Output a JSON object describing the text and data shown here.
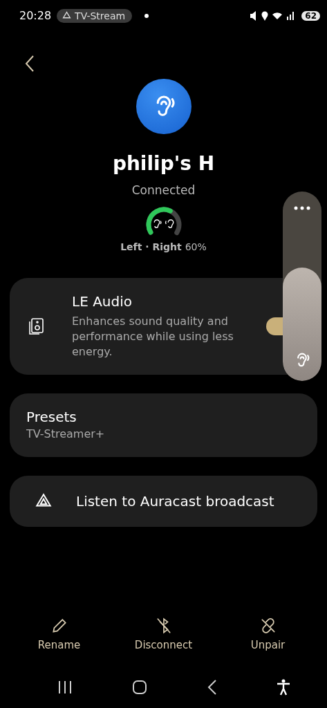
{
  "status_bar": {
    "time": "20:28",
    "chip": "TV-Stream",
    "battery": "62"
  },
  "device": {
    "name": "philip's H",
    "status": "Connected",
    "battery": {
      "label": "Left · Right",
      "reading": "60%"
    }
  },
  "settings": [
    {
      "kind": "toggle",
      "title": "LE Audio",
      "description": "Enhances sound quality and performance while using less energy.",
      "on": true
    },
    {
      "kind": "value",
      "title": "Presets",
      "value": "TV-Streamer+"
    },
    {
      "kind": "link",
      "title": "Listen to Auracast broadcast"
    }
  ],
  "actions": [
    {
      "label": "Rename",
      "kind": "rename"
    },
    {
      "label": "Disconnect",
      "kind": "disconnect"
    },
    {
      "label": "Unpair",
      "kind": "unpair"
    }
  ],
  "volume": {
    "level": 0.6
  }
}
